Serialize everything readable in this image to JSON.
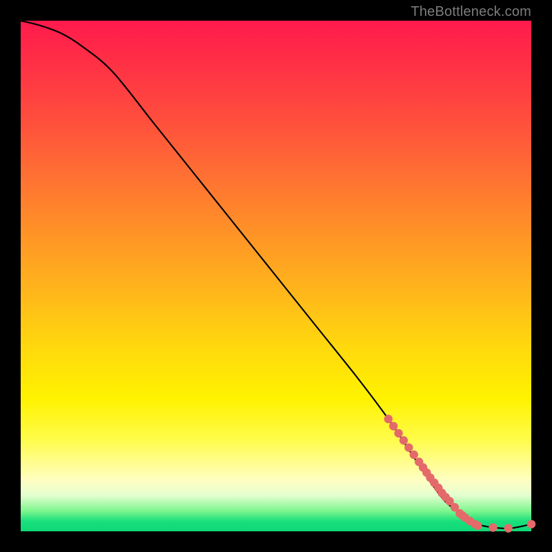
{
  "watermark": "TheBottleneck.com",
  "chart_data": {
    "type": "line",
    "title": "",
    "xlabel": "",
    "ylabel": "",
    "xlim": [
      0,
      100
    ],
    "ylim": [
      0,
      100
    ],
    "series": [
      {
        "name": "curve",
        "style": "line",
        "x": [
          0,
          4,
          8,
          12,
          18,
          26,
          34,
          42,
          50,
          58,
          66,
          72,
          76,
          80,
          83,
          86,
          88,
          90,
          93,
          96,
          100
        ],
        "y": [
          100,
          99,
          97.5,
          95,
          90,
          80,
          70,
          60,
          50,
          40,
          30,
          22,
          16,
          10,
          6,
          3.5,
          2,
          1.2,
          0.7,
          0.6,
          1.4
        ]
      },
      {
        "name": "points",
        "style": "scatter",
        "x": [
          72,
          73,
          74,
          75,
          76,
          77,
          78,
          78.8,
          79.5,
          80.2,
          81,
          81.8,
          82.5,
          83.2,
          84,
          85,
          86,
          86.5,
          87,
          88,
          89,
          89.5,
          92.5,
          95.5,
          100
        ],
        "y": [
          22,
          20.6,
          19.2,
          17.8,
          16.4,
          15,
          13.6,
          12.5,
          11.5,
          10.5,
          9.5,
          8.5,
          7.5,
          6.7,
          5.9,
          4.7,
          3.5,
          3.1,
          2.7,
          2.0,
          1.4,
          1.1,
          0.75,
          0.6,
          1.4
        ]
      }
    ],
    "colors": {
      "curve": "#000000",
      "points_fill": "#e46a6a",
      "points_stroke": "#c94e4e"
    }
  }
}
